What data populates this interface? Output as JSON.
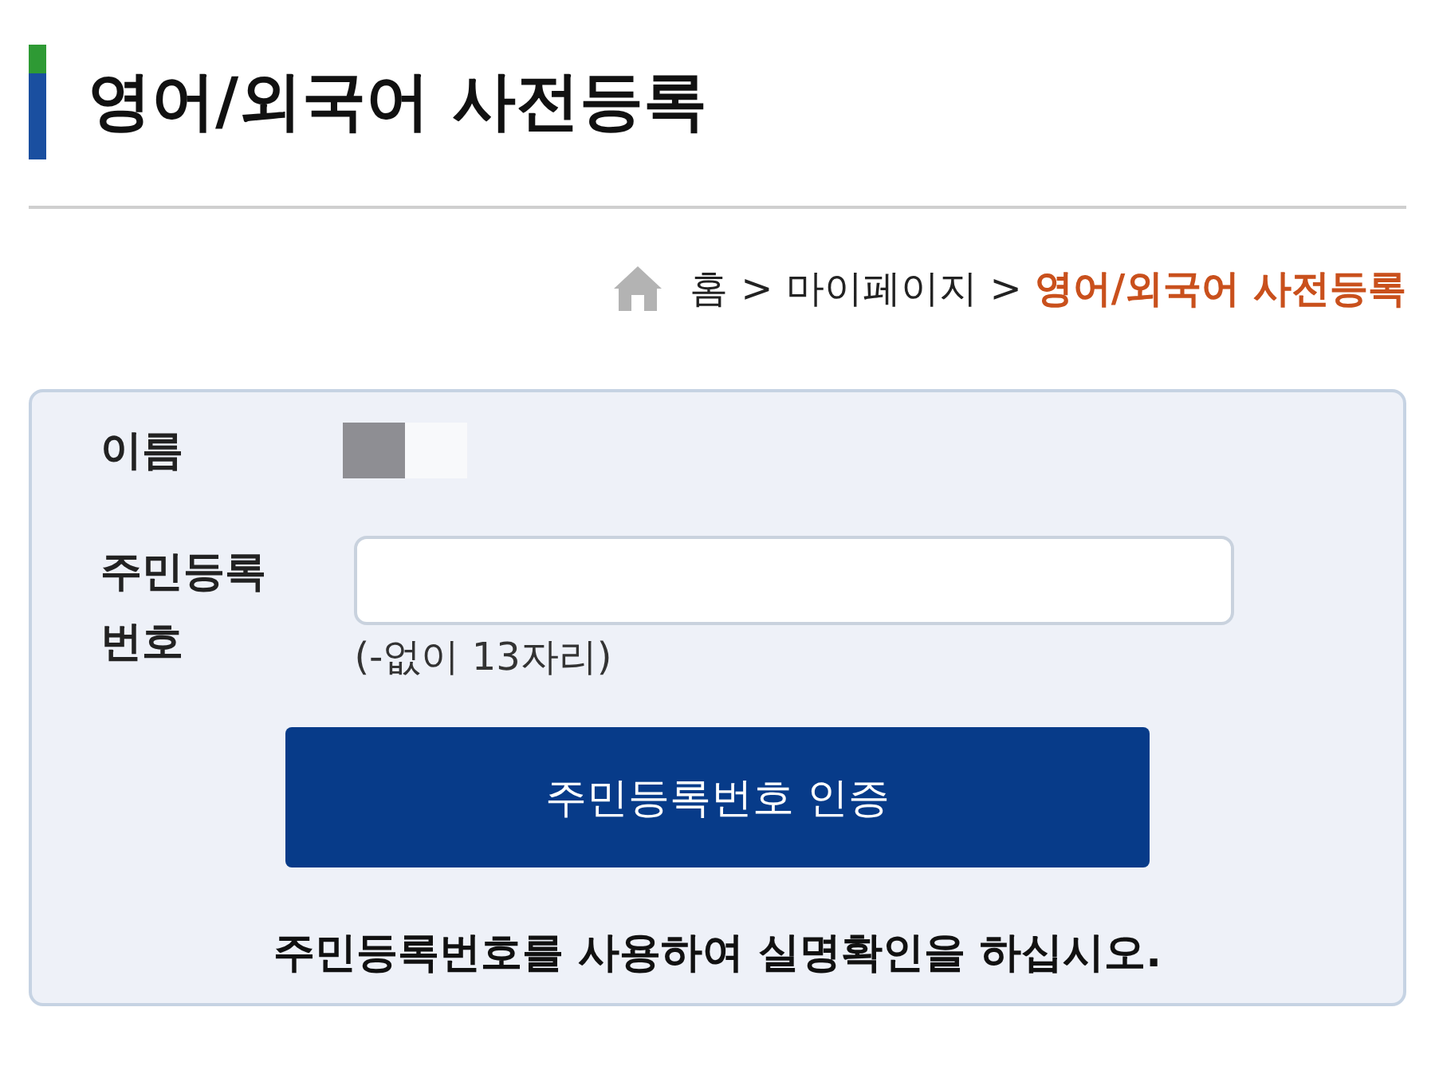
{
  "page_title": "영어/외국어 사전등록",
  "breadcrumb": [
    {
      "kind": "home",
      "label": "홈"
    },
    {
      "kind": "separator",
      "label": ">"
    },
    {
      "kind": "link",
      "label": "마이페이지"
    },
    {
      "kind": "separator",
      "label": ">"
    },
    {
      "kind": "current",
      "label": "영어/외국어 사전등록"
    }
  ],
  "form": {
    "name": {
      "label": "이름",
      "masked": true
    },
    "resident_number": {
      "label": "주민등록번호",
      "hint": "(-없이 13자리)"
    },
    "verify_button": "주민등록번호 인증",
    "notice": "주민등록번호를 사용하여 실명확인을 하십시오."
  }
}
